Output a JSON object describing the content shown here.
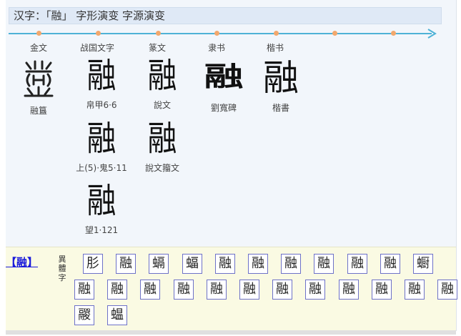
{
  "header": {
    "title": "汉字：「融」 字形演变 字源演变"
  },
  "eras": [
    "金文",
    "战国文字",
    "篆文",
    "隶书",
    "楷书"
  ],
  "glyphs": {
    "jin": {
      "glyph": "融",
      "caption": "融簋"
    },
    "zhanguo1": {
      "glyph": "融",
      "caption": "帛甲6·6"
    },
    "zhanguo2": {
      "glyph": "融",
      "caption": "上(5)·鬼5·11"
    },
    "zhanguo3": {
      "glyph": "融",
      "caption": "望1·121"
    },
    "zhuan1": {
      "glyph": "融",
      "caption": "說文"
    },
    "zhuan2": {
      "glyph": "融",
      "caption": "說文籀文"
    },
    "li": {
      "glyph": "融",
      "caption": "劉寬碑"
    },
    "kai": {
      "glyph": "融",
      "caption": "楷書"
    }
  },
  "variants_section": {
    "char_link": "【融】",
    "label": "異體字",
    "variants": [
      "肜",
      "融",
      "螎",
      "蝠",
      "融",
      "融",
      "融",
      "融",
      "融",
      "融",
      "蟵",
      "融",
      "融",
      "融",
      "融",
      "融",
      "融",
      "融",
      "融",
      "融",
      "融",
      "融",
      "融",
      "鬷",
      "蝹"
    ]
  },
  "colors": {
    "timeline": "#4fb2d6",
    "timeline_dot": "#f2a86d",
    "variant_border": "#6e72c8",
    "link": "#1a1adb"
  }
}
